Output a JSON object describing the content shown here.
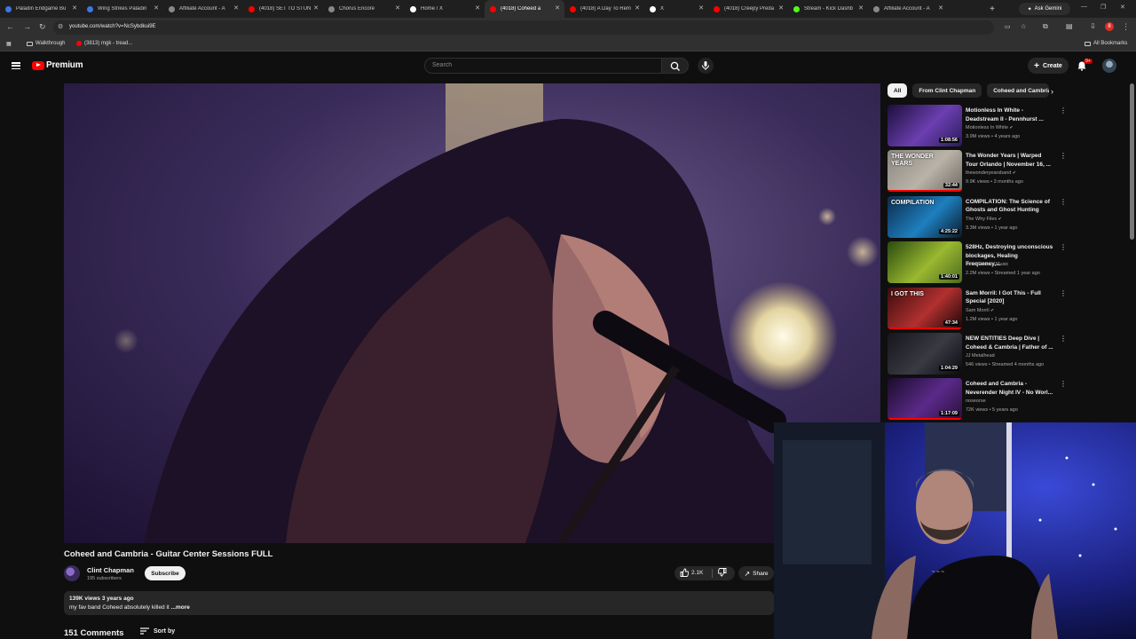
{
  "browser": {
    "tabs": [
      {
        "title": "Paladin Endgame Bu",
        "color": "#3b78e7"
      },
      {
        "title": "Wing Strikes Paladin",
        "color": "#3b78e7"
      },
      {
        "title": "Affiliate Account - A",
        "color": "#888888"
      },
      {
        "title": "(4018) SET TO STUN",
        "color": "#ff0000"
      },
      {
        "title": "Chorus Encore",
        "color": "#888888"
      },
      {
        "title": "Home / X",
        "color": "#ffffff"
      },
      {
        "title": "(4018) Coheed a",
        "color": "#ff0000",
        "active": true
      },
      {
        "title": "(4018) A Day To Rem",
        "color": "#ff0000"
      },
      {
        "title": "X",
        "color": "#ffffff"
      },
      {
        "title": "(4018) Creepy Preda",
        "color": "#ff0000"
      },
      {
        "title": "Stream - Kick Dashb",
        "color": "#53fc18"
      },
      {
        "title": "Affiliate Account - A",
        "color": "#888888"
      }
    ],
    "new_tab": "+",
    "ask_gemini": "Ask Gemini",
    "url": "youtube.com/watch?v=NcSybdkui9E",
    "bookmarks": [
      {
        "label": "Walkthrough"
      },
      {
        "label": "(3813) mgk - tread..."
      }
    ],
    "all_bookmarks": "All Bookmarks",
    "profile_letter": "8"
  },
  "youtube": {
    "logo_text": "Premium",
    "search_placeholder": "Search",
    "create_label": "Create",
    "notif_badge": "9+",
    "video": {
      "title": "Coheed and Cambria - Guitar Center Sessions FULL",
      "channel": "Clint Chapman",
      "subscribers": "195 subscribers",
      "subscribe_label": "Subscribe",
      "likes": "2.1K",
      "share_label": "Share",
      "views_age": "139K views  3 years ago",
      "description": "my fav band Coheed absolutely killed it",
      "more_label": " ...more",
      "comments_count": "151 Comments",
      "sort_label": "Sort by"
    },
    "chips": [
      "All",
      "From Clint Chapman",
      "Coheed and Cambria"
    ],
    "recommendations": [
      {
        "title": "Motionless In White - Deadstream II - Pennhurst ...",
        "channel": "Motionless In White",
        "verified": true,
        "meta": "3.9M views • 4 years ago",
        "duration": "1:08:56",
        "progress": 0.0,
        "thumb_colors": [
          "#1b0f3a",
          "#6b3fb0",
          "#2a1b5c"
        ]
      },
      {
        "title": "The Wonder Years | Warped Tour Orlando | November 16, ...",
        "channel": "thewonderyearsband",
        "verified": true,
        "meta": "9.9K views • 3 months ago",
        "duration": "32:44",
        "progress": 1.0,
        "thumb_text": "THE WONDER YEARS",
        "thumb_colors": [
          "#8a8580",
          "#b9b3a8",
          "#6d6861"
        ]
      },
      {
        "title": "COMPILATION: The Science of Ghosts and Ghost Hunting",
        "channel": "The Why Files",
        "verified": true,
        "meta": "3.3M views • 1 year ago",
        "duration": "4:25:22",
        "progress": 0.0,
        "thumb_text": "COMPILATION",
        "thumb_colors": [
          "#0c2a4a",
          "#1e7fbf",
          "#0a1a2a"
        ]
      },
      {
        "title": "528Hz, Destroying unconscious blockages, Healing Frequency,...",
        "channel": "Inner Peaces Music",
        "verified": false,
        "meta": "2.2M views • Streamed 1 year ago",
        "duration": "1:40:01",
        "progress": 0.0,
        "thumb_colors": [
          "#2a4a10",
          "#9ab830",
          "#4a6a20"
        ]
      },
      {
        "title": "Sam Morril: I Got This - Full Special [2020]",
        "channel": "Sam Morril",
        "verified": true,
        "meta": "1.2M views • 1 year ago",
        "duration": "47:34",
        "progress": 1.0,
        "thumb_text": "I GOT THIS",
        "thumb_colors": [
          "#3a0c0c",
          "#b23030",
          "#1a0505"
        ]
      },
      {
        "title": "NEW ENTITIES Deep Dive | Coheed & Cambria | Father of ...",
        "channel": "JJ Metalhead",
        "verified": false,
        "meta": "546 views • Streamed 4 months ago",
        "duration": "1:04:29",
        "progress": 0.0,
        "thumb_colors": [
          "#15151a",
          "#3a3a44",
          "#0a0a10"
        ]
      },
      {
        "title": "Coheed and Cambria - Neverender Night IV - No Worl...",
        "channel": "noseorse",
        "verified": false,
        "meta": "72K views • 5 years ago",
        "duration": "1:17:09",
        "progress": 1.0,
        "thumb_colors": [
          "#1a0c2a",
          "#5a2a8a",
          "#2a103a"
        ]
      }
    ]
  }
}
